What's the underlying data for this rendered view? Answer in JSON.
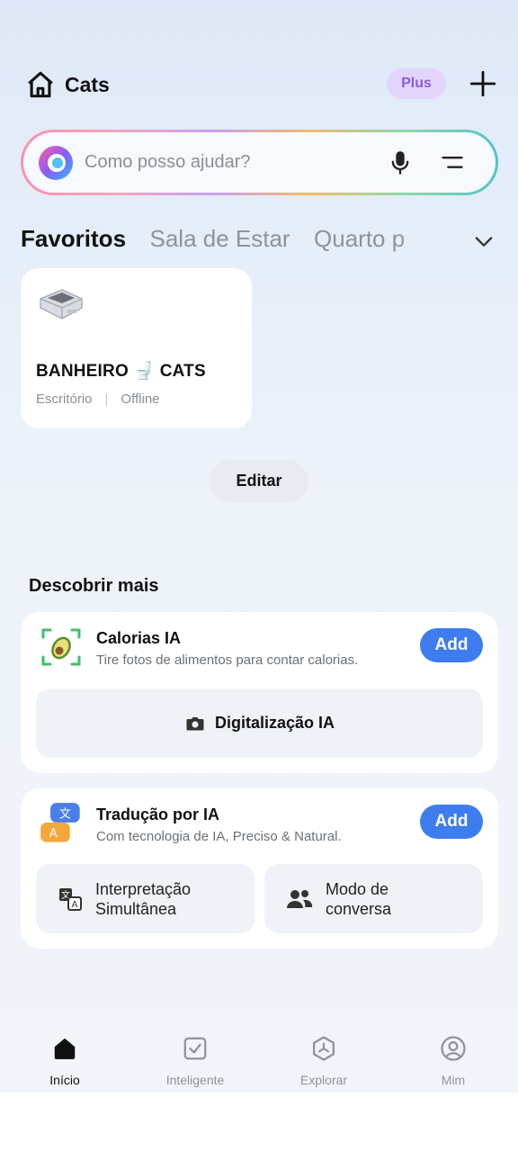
{
  "header": {
    "home_name": "Cats",
    "plus_badge": "Plus"
  },
  "search": {
    "placeholder": "Como posso ajudar?"
  },
  "rooms": {
    "tabs": [
      "Favoritos",
      "Sala de Estar",
      "Quarto p"
    ],
    "active_index": 0
  },
  "device": {
    "name": "BANHEIRO 🚽 CATS",
    "room": "Escritório",
    "separator": "|",
    "status": "Offline"
  },
  "edit_label": "Editar",
  "discover": {
    "title": "Descobrir mais",
    "cards": [
      {
        "title": "Calorias IA",
        "subtitle": "Tire fotos de alimentos para contar calorias.",
        "add_label": "Add",
        "icon": "avocado-scan-icon",
        "actions": [
          {
            "label": "Digitalização IA",
            "icon": "camera-icon"
          }
        ]
      },
      {
        "title": "Tradução por IA",
        "subtitle": "Com tecnologia de IA, Preciso & Natural.",
        "add_label": "Add",
        "icon": "translate-bubbles-icon",
        "actions": [
          {
            "label": "Interpretação Simultânea",
            "icon": "translate-icon"
          },
          {
            "label": "Modo de conversa",
            "icon": "people-icon"
          }
        ]
      }
    ]
  },
  "nav": {
    "items": [
      {
        "label": "Início",
        "icon": "home-icon"
      },
      {
        "label": "Inteligente",
        "icon": "check-square-icon"
      },
      {
        "label": "Explorar",
        "icon": "compass-icon"
      },
      {
        "label": "Mim",
        "icon": "profile-icon"
      }
    ],
    "active_index": 0
  },
  "colors": {
    "accent": "#3d7df0",
    "plus_bg": "#e2d4fb",
    "plus_text": "#8a5ce0"
  }
}
